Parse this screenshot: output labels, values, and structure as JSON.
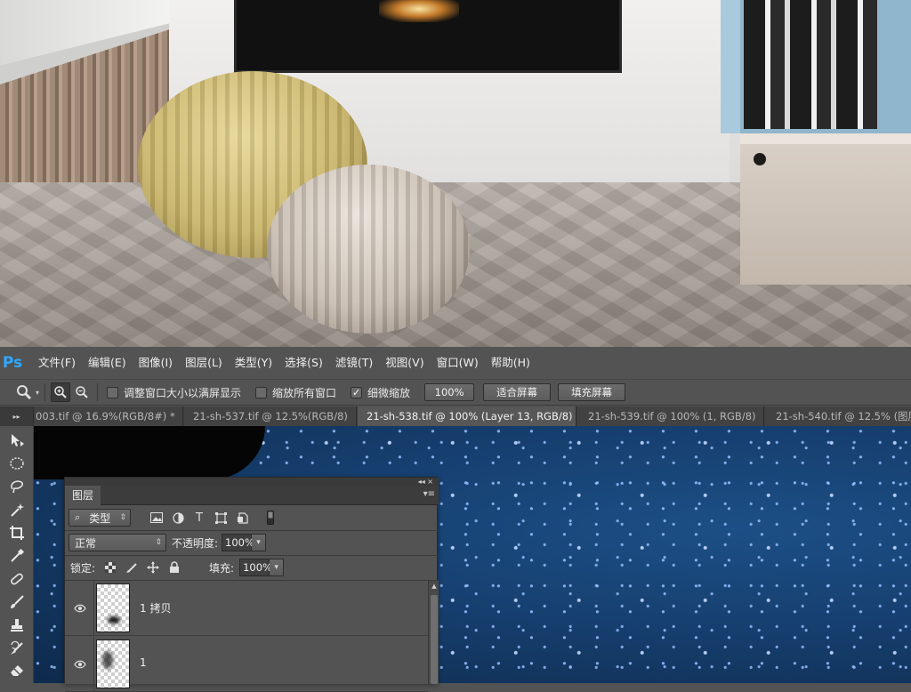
{
  "app": {
    "logo": "Ps",
    "menu": [
      "文件(F)",
      "编辑(E)",
      "图像(I)",
      "图层(L)",
      "类型(Y)",
      "选择(S)",
      "滤镜(T)",
      "视图(V)",
      "窗口(W)",
      "帮助(H)"
    ]
  },
  "options_bar": {
    "tool_icon": "zoom-tool-icon",
    "zoom_in_icon": "zoom-in-icon",
    "zoom_out_icon": "zoom-out-icon",
    "resize_windows_label": "调整窗口大小以满屏显示",
    "resize_windows_checked": false,
    "zoom_all_label": "缩放所有窗口",
    "zoom_all_checked": false,
    "scrubby_label": "细微缩放",
    "scrubby_checked": true,
    "btn_100": "100%",
    "btn_fit": "适合屏幕",
    "btn_fill": "填充屏幕"
  },
  "tabs": [
    {
      "label": "003.tif @ 16.9%(RGB/8#) *",
      "active": false
    },
    {
      "label": "21-sh-537.tif @ 12.5%(RGB/8)",
      "active": false
    },
    {
      "label": "21-sh-538.tif @ 100% (Layer 13, RGB/8)",
      "active": true
    },
    {
      "label": "21-sh-539.tif @ 100% (1, RGB/8)",
      "active": false
    },
    {
      "label": "21-sh-540.tif @ 12.5% (图层",
      "active": false
    }
  ],
  "tools": [
    "move-tool-icon",
    "marquee-tool-icon",
    "lasso-tool-icon",
    "magic-wand-tool-icon",
    "crop-tool-icon",
    "eyedropper-tool-icon",
    "healing-brush-tool-icon",
    "brush-tool-icon",
    "clone-stamp-tool-icon",
    "history-brush-tool-icon",
    "eraser-tool-icon"
  ],
  "layers_panel": {
    "title": "图层",
    "filter_label": "类型",
    "blend_mode": "正常",
    "opacity_label": "不透明度:",
    "opacity_value": "100%",
    "lock_label": "锁定:",
    "fill_label": "填充:",
    "fill_value": "100%",
    "layers": [
      {
        "name": "1 拷贝",
        "visible": true
      },
      {
        "name": "1",
        "visible": true
      }
    ]
  },
  "colors": {
    "ps_logo": "#31a8ff",
    "ui_background": "#535353",
    "canvas_blue": "#163f6f"
  }
}
